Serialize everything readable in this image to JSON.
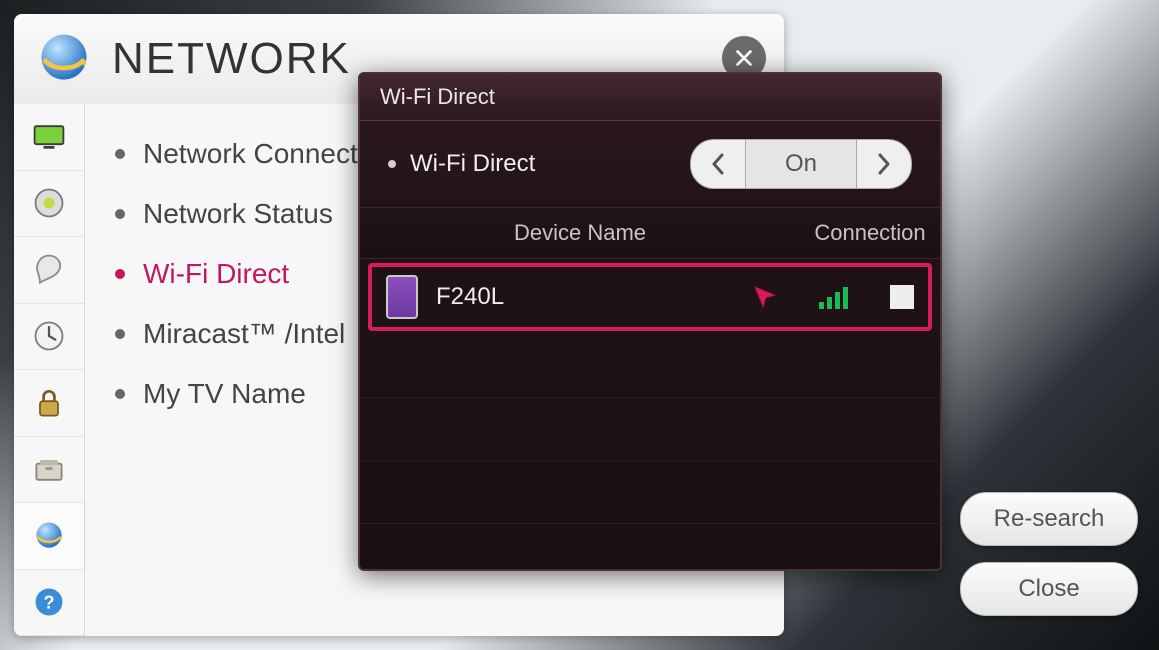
{
  "header": {
    "title": "NETWORK"
  },
  "menu": {
    "items": [
      {
        "label": "Network Connection"
      },
      {
        "label": "Network Status"
      },
      {
        "label": "Wi-Fi Direct"
      },
      {
        "label": "Miracast™ /Intel"
      },
      {
        "label": "My TV Name"
      }
    ],
    "selected_index": 2
  },
  "modal": {
    "title": "Wi-Fi Direct",
    "toggle_label": "Wi-Fi Direct",
    "toggle_value": "On",
    "col_device": "Device Name",
    "col_conn": "Connection",
    "devices": [
      {
        "name": "F240L"
      }
    ]
  },
  "actions": {
    "research": "Re-search",
    "close": "Close"
  }
}
